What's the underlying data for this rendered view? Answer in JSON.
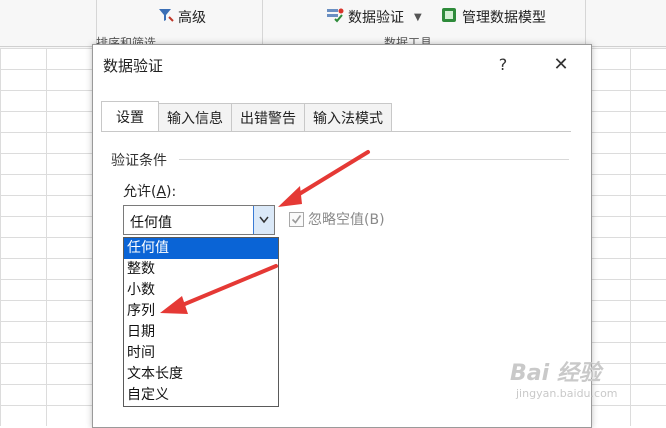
{
  "ribbon": {
    "item_advanced": "高级",
    "item_data_validation": "数据验证",
    "item_manage_model": "管理数据模型",
    "group_sort_filter": "排序和筛选",
    "group_data_tools": "数据工具"
  },
  "dialog": {
    "title": "数据验证",
    "help": "?",
    "close": "✕",
    "tabs": [
      "设置",
      "输入信息",
      "出错警告",
      "输入法模式"
    ],
    "section_label": "验证条件",
    "allow_prefix": "允许(",
    "allow_key": "A",
    "allow_suffix": "):",
    "allow_value": "任何值",
    "ignore_blank": "忽略空值(B)",
    "options": [
      "任何值",
      "整数",
      "小数",
      "序列",
      "日期",
      "时间",
      "文本长度",
      "自定义"
    ]
  },
  "watermark": {
    "main": "Bai 经验",
    "sub": "jingyan.baidu.com"
  },
  "colors": {
    "selection": "#0a64d6",
    "arrow": "#e53935"
  },
  "icons": [
    "advanced-filter-icon",
    "data-validation-icon",
    "manage-data-model-icon",
    "dropdown-arrow-icon",
    "checkbox-check-icon",
    "help-icon",
    "close-icon"
  ]
}
